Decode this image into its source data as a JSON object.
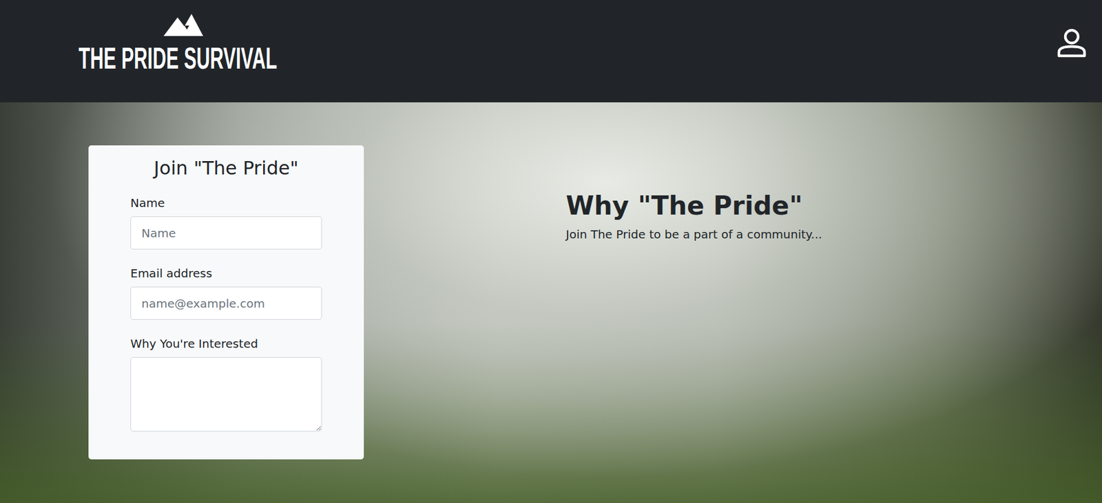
{
  "header": {
    "title": "THE PRIDE SURVIVAL"
  },
  "form": {
    "title": "Join \"The Pride\"",
    "fields": [
      {
        "label": "Name",
        "placeholder": "Name",
        "kind": "input"
      },
      {
        "label": "Email address",
        "placeholder": "name@example.com",
        "kind": "input"
      },
      {
        "label": "Why You're Interested",
        "placeholder": "",
        "kind": "textarea"
      }
    ]
  },
  "info": {
    "title": "Why \"The Pride\"",
    "text": "Join The Pride to be a part of a community..."
  }
}
